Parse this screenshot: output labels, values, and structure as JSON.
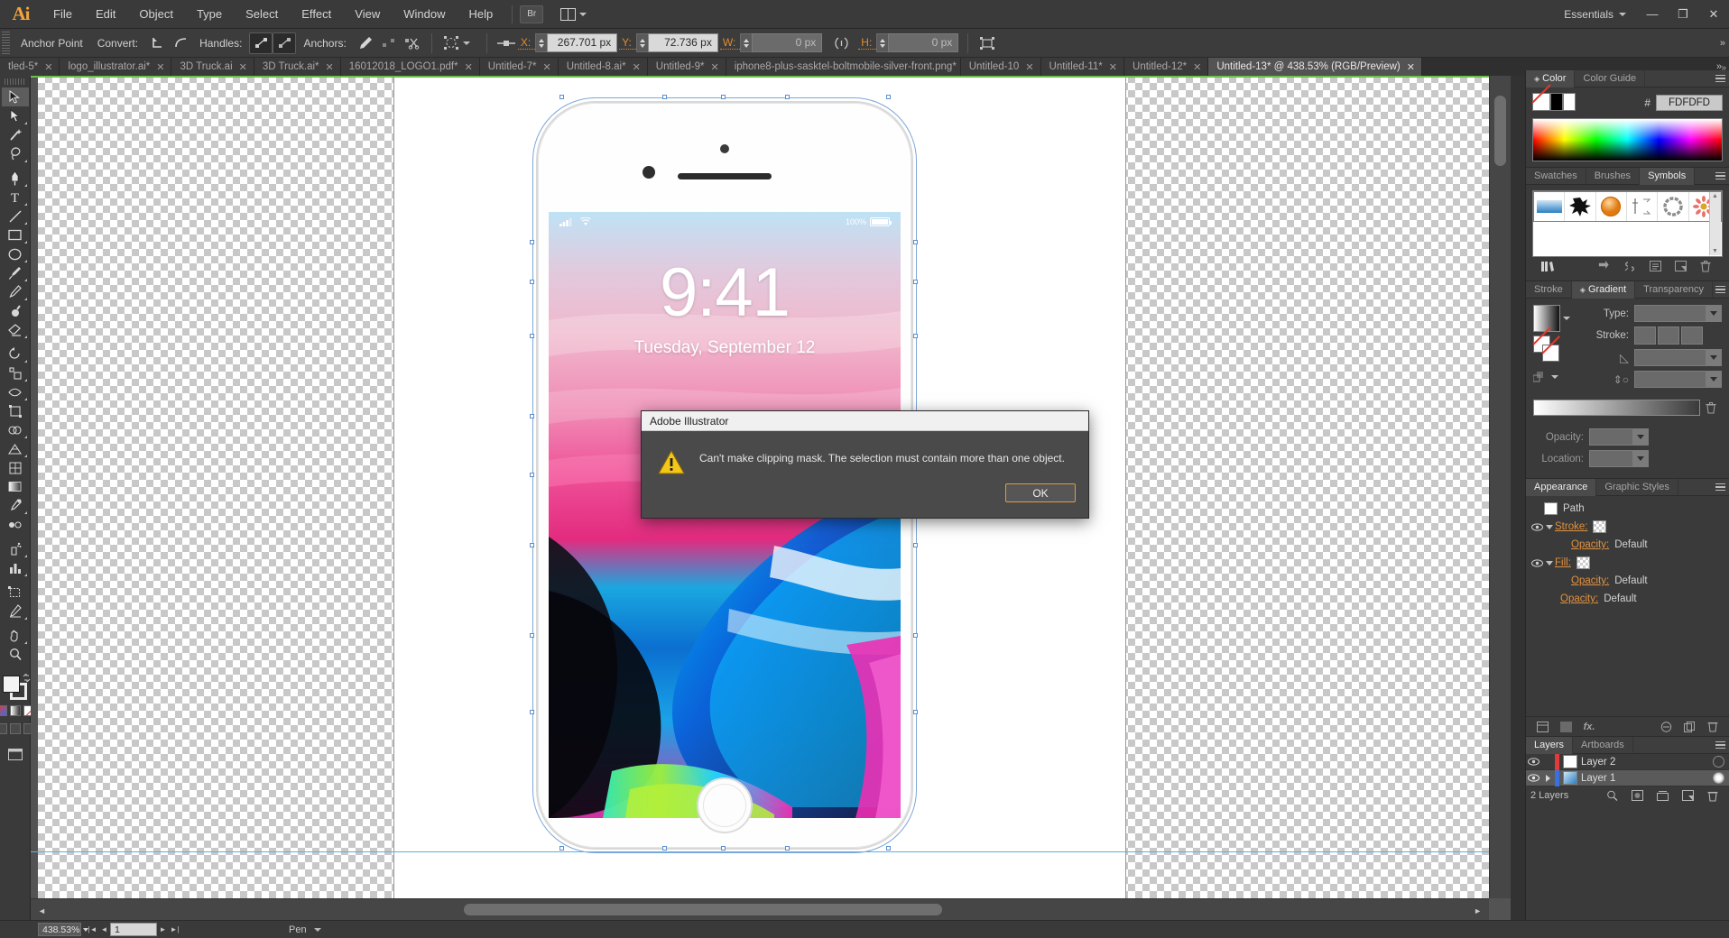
{
  "app": {
    "name": "Adobe Illustrator",
    "logo": "Ai"
  },
  "menubar": {
    "items": [
      "File",
      "Edit",
      "Object",
      "Type",
      "Select",
      "Effect",
      "View",
      "Window",
      "Help"
    ],
    "bridge_label": "Br",
    "workspace": "Essentials",
    "window_buttons": {
      "minimize": "—",
      "restore": "❐",
      "close": "✕"
    }
  },
  "controlbar": {
    "context_label": "Anchor Point",
    "convert_label": "Convert:",
    "handles_label": "Handles:",
    "anchors_label": "Anchors:",
    "x_label": "X:",
    "x_value": "267.701 px",
    "y_label": "Y:",
    "y_value": "72.736 px",
    "w_label": "W:",
    "w_value": "0 px",
    "h_label": "H:",
    "h_value": "0 px"
  },
  "tabs": {
    "items": [
      {
        "label": "tled-5*",
        "dirty": true,
        "active": false
      },
      {
        "label": "logo_illustrator.ai*",
        "dirty": true,
        "active": false
      },
      {
        "label": "3D Truck.ai",
        "dirty": false,
        "active": false
      },
      {
        "label": "3D Truck.ai*",
        "dirty": true,
        "active": false
      },
      {
        "label": "16012018_LOGO1.pdf*",
        "dirty": true,
        "active": false
      },
      {
        "label": "Untitled-7*",
        "dirty": true,
        "active": false
      },
      {
        "label": "Untitled-8.ai*",
        "dirty": true,
        "active": false
      },
      {
        "label": "Untitled-9*",
        "dirty": true,
        "active": false
      },
      {
        "label": "iphone8-plus-sasktel-boltmobile-silver-front.png*",
        "dirty": true,
        "active": false
      },
      {
        "label": "Untitled-10",
        "dirty": false,
        "active": false
      },
      {
        "label": "Untitled-11*",
        "dirty": true,
        "active": false
      },
      {
        "label": "Untitled-12*",
        "dirty": true,
        "active": false
      },
      {
        "label": "Untitled-13* @ 438.53% (RGB/Preview)",
        "dirty": true,
        "active": true
      }
    ],
    "close_glyph": "✕",
    "overflow_glyph": "»"
  },
  "toolbar": {
    "tools": [
      "selection-tool",
      "direct-selection-tool",
      "magic-wand-tool",
      "lasso-tool",
      "pen-tool",
      "type-tool",
      "line-segment-tool",
      "rectangle-tool",
      "ellipse-tool",
      "paintbrush-tool",
      "pencil-tool",
      "blob-brush-tool",
      "eraser-tool",
      "rotate-tool",
      "scale-tool",
      "width-tool",
      "free-transform-tool",
      "shape-builder-tool",
      "perspective-grid-tool",
      "mesh-tool",
      "gradient-tool",
      "eyedropper-tool",
      "blend-tool",
      "symbol-sprayer-tool",
      "column-graph-tool",
      "artboard-tool",
      "slice-tool",
      "hand-tool",
      "zoom-tool"
    ],
    "fill_color": "#F4F4F4",
    "stroke_color": "#ECECEC"
  },
  "canvas": {
    "zoom_percent": "438.53%",
    "artboard_background": "#FFFFFF"
  },
  "artwork": {
    "device": "iPhone 8 Plus - Silver",
    "lock_time": "9:41",
    "lock_date": "Tuesday, September 12",
    "battery_percent": "100%",
    "carrier_signal": "signal-bars-icon",
    "wifi": "wifi-icon"
  },
  "dialog": {
    "title": "Adobe Illustrator",
    "icon": "warning-icon",
    "message": "Can't make clipping mask. The selection must contain more than one object.",
    "ok_label": "OK"
  },
  "panels": {
    "color": {
      "tabs": [
        "Color",
        "Color Guide"
      ],
      "active_tab": "Color",
      "hash_symbol": "#",
      "hex_value": "FDFDFD"
    },
    "symbols": {
      "tabs": [
        "Swatches",
        "Brushes",
        "Symbols"
      ],
      "active_tab": "Symbols",
      "items": [
        "blue-gradient-symbol",
        "black-splatter-symbol",
        "orange-circle-symbol",
        "arrows-symbol",
        "grey-ring-symbol",
        "red-flower-symbol"
      ]
    },
    "gradient": {
      "tabs": [
        "Stroke",
        "Gradient",
        "Transparency"
      ],
      "active_tab": "Gradient",
      "type_label": "Type:",
      "type_value": "",
      "stroke_label": "Stroke:",
      "angle_value": "",
      "aspect_value": "",
      "opacity_label": "Opacity:",
      "opacity_value": "",
      "location_label": "Location:",
      "location_value": ""
    },
    "appearance": {
      "tabs": [
        "Appearance",
        "Graphic Styles"
      ],
      "active_tab": "Appearance",
      "object_type": "Path",
      "rows": [
        {
          "label": "Stroke:",
          "value": "",
          "type": "link"
        },
        {
          "label": "Opacity:",
          "value": "Default",
          "type": "sub"
        },
        {
          "label": "Fill:",
          "value": "",
          "type": "link"
        },
        {
          "label": "Opacity:",
          "value": "Default",
          "type": "sub"
        },
        {
          "label": "Opacity:",
          "value": "Default",
          "type": "sub"
        }
      ]
    },
    "layers": {
      "tabs": [
        "Layers",
        "Artboards"
      ],
      "active_tab": "Layers",
      "rows": [
        {
          "name": "Layer 2",
          "color": "#e03a3a",
          "selected": false
        },
        {
          "name": "Layer 1",
          "color": "#3a6fe0",
          "selected": true
        }
      ],
      "footer_count": "2 Layers"
    }
  },
  "statusbar": {
    "zoom_value": "438.53%",
    "page_value": "1",
    "tool_name": "Pen"
  }
}
